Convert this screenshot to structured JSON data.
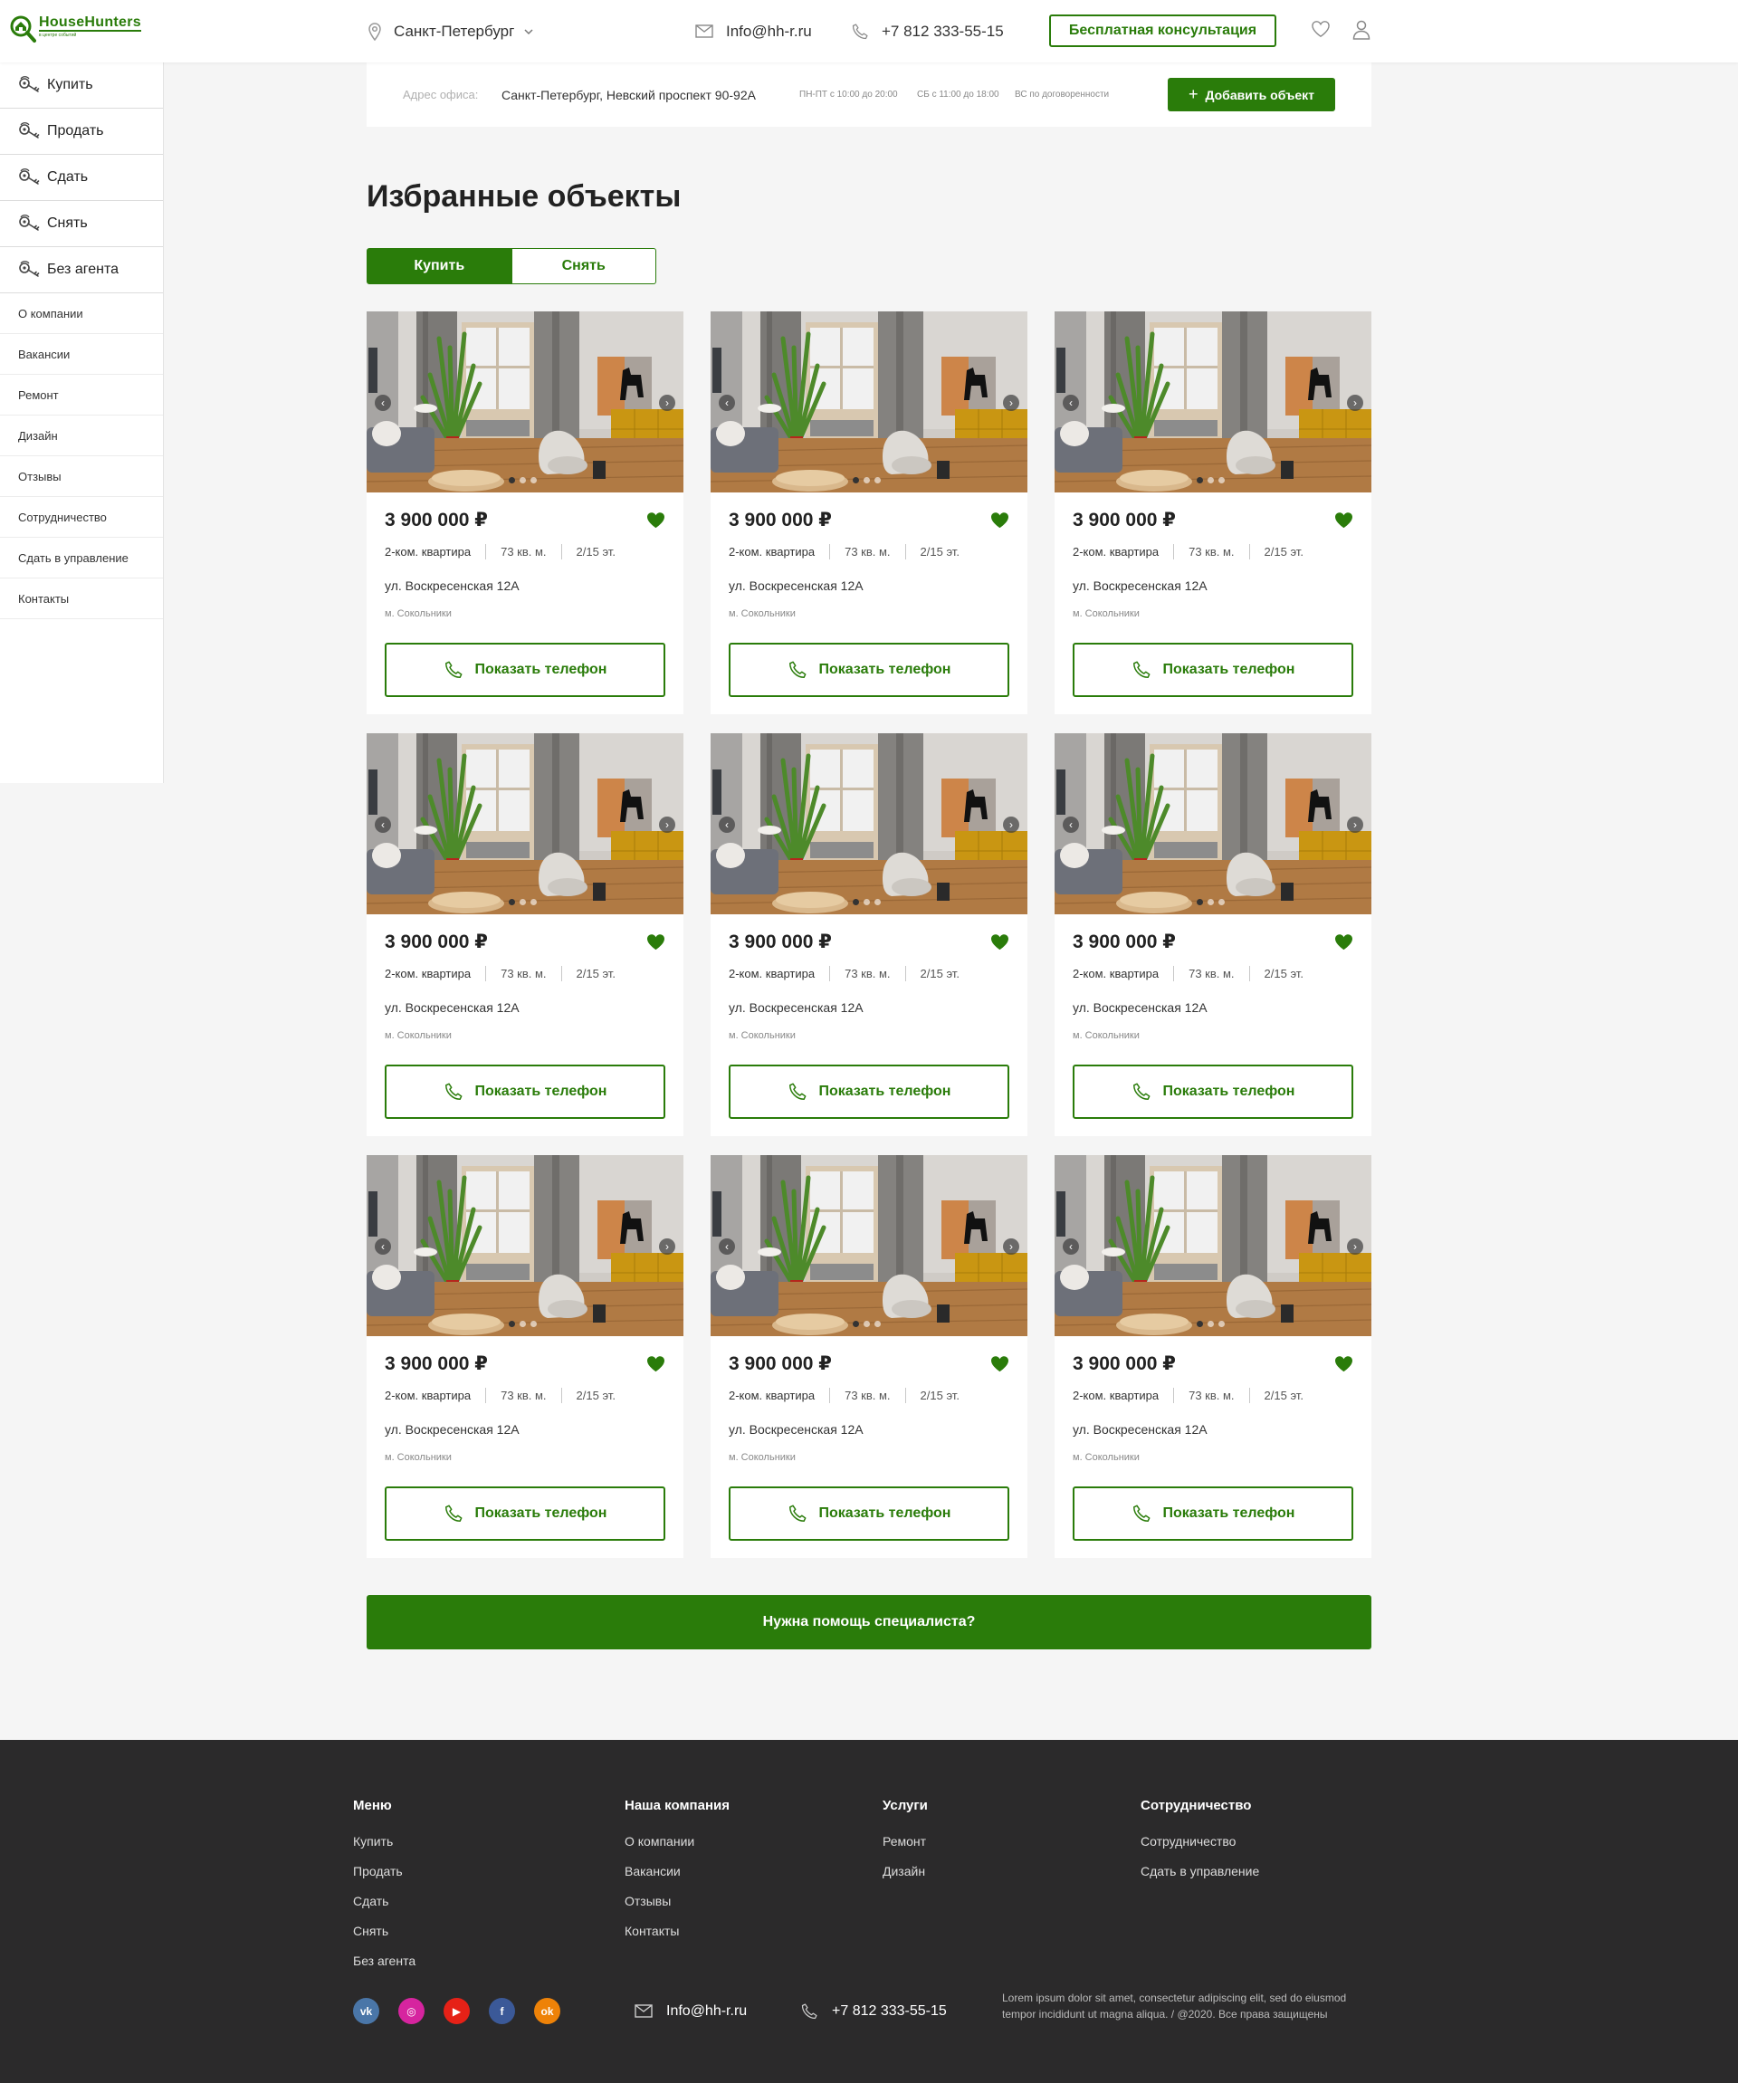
{
  "brand": {
    "name": "HouseHunters",
    "tagline": "в центре событий",
    "color": "#2a7c0a"
  },
  "header": {
    "city": "Санкт-Петербург",
    "email": "Info@hh-r.ru",
    "phone": "+7 812 333-55-15",
    "consult_label": "Бесплатная консультация",
    "icons": [
      "location-pin-icon",
      "chevron-down-icon",
      "mail-icon",
      "phone-icon",
      "heart-icon",
      "user-icon"
    ]
  },
  "sidebar": {
    "main_items": [
      {
        "label": "Купить",
        "icon": "key-icon"
      },
      {
        "label": "Продать",
        "icon": "key-icon"
      },
      {
        "label": "Сдать",
        "icon": "key-icon"
      },
      {
        "label": "Снять",
        "icon": "key-icon"
      },
      {
        "label": "Без агента",
        "icon": "key-icon"
      }
    ],
    "sub_items": [
      "О компании",
      "Вакансии",
      "Ремонт",
      "Дизайн",
      "Отзывы",
      "Сотрудничество",
      "Сдать в управление",
      "Контакты"
    ]
  },
  "office": {
    "label": "Адрес офиса:",
    "address": "Санкт-Петербург, Невский проспект 90-92А",
    "hours_weekdays": "ПН-ПТ с 10:00 до 20:00",
    "hours_saturday": "СБ с 11:00 до 18:00",
    "hours_sunday": "ВС по договоренности",
    "add_label": "Добавить объект"
  },
  "page": {
    "title": "Избранные объекты",
    "tabs": [
      {
        "label": "Купить",
        "active": true
      },
      {
        "label": "Снять",
        "active": false
      }
    ]
  },
  "listings": [
    {
      "price": "3 900 000 ₽",
      "rooms": "2-ком. квартира",
      "area": "73 кв. м.",
      "floor": "2/15 эт.",
      "street": "ул. Воскресенская 12А",
      "metro": "м. Сокольники",
      "button": "Показать телефон",
      "favorite": true,
      "slide": 1
    },
    {
      "price": "3 900 000 ₽",
      "rooms": "2-ком. квартира",
      "area": "73 кв. м.",
      "floor": "2/15 эт.",
      "street": "ул. Воскресенская 12А",
      "metro": "м. Сокольники",
      "button": "Показать телефон",
      "favorite": true,
      "slide": 1
    },
    {
      "price": "3 900 000 ₽",
      "rooms": "2-ком. квартира",
      "area": "73 кв. м.",
      "floor": "2/15 эт.",
      "street": "ул. Воскресенская 12А",
      "metro": "м. Сокольники",
      "button": "Показать телефон",
      "favorite": true,
      "slide": 1
    },
    {
      "price": "3 900 000 ₽",
      "rooms": "2-ком. квартира",
      "area": "73 кв. м.",
      "floor": "2/15 эт.",
      "street": "ул. Воскресенская 12А",
      "metro": "м. Сокольники",
      "button": "Показать телефон",
      "favorite": true,
      "slide": 1
    },
    {
      "price": "3 900 000 ₽",
      "rooms": "2-ком. квартира",
      "area": "73 кв. м.",
      "floor": "2/15 эт.",
      "street": "ул. Воскресенская 12А",
      "metro": "м. Сокольники",
      "button": "Показать телефон",
      "favorite": true,
      "slide": 1
    },
    {
      "price": "3 900 000 ₽",
      "rooms": "2-ком. квартира",
      "area": "73 кв. м.",
      "floor": "2/15 эт.",
      "street": "ул. Воскресенская 12А",
      "metro": "м. Сокольники",
      "button": "Показать телефон",
      "favorite": true,
      "slide": 1
    },
    {
      "price": "3 900 000 ₽",
      "rooms": "2-ком. квартира",
      "area": "73 кв. м.",
      "floor": "2/15 эт.",
      "street": "ул. Воскресенская 12А",
      "metro": "м. Сокольники",
      "button": "Показать телефон",
      "favorite": true,
      "slide": 1
    },
    {
      "price": "3 900 000 ₽",
      "rooms": "2-ком. квартира",
      "area": "73 кв. м.",
      "floor": "2/15 эт.",
      "street": "ул. Воскресенская 12А",
      "metro": "м. Сокольники",
      "button": "Показать телефон",
      "favorite": true,
      "slide": 1
    },
    {
      "price": "3 900 000 ₽",
      "rooms": "2-ком. квартира",
      "area": "73 кв. м.",
      "floor": "2/15 эт.",
      "street": "ул. Воскресенская 12А",
      "metro": "м. Сокольники",
      "button": "Показать телефон",
      "favorite": true,
      "slide": 1
    }
  ],
  "help_label": "Нужна помощь специалиста?",
  "footer": {
    "columns": [
      {
        "title": "Меню",
        "links": [
          "Купить",
          "Продать",
          "Сдать",
          "Снять",
          "Без агента"
        ]
      },
      {
        "title": "Наша компания",
        "links": [
          "О компании",
          "Вакансии",
          "Отзывы",
          "Контакты"
        ]
      },
      {
        "title": "Услуги",
        "links": [
          "Ремонт",
          "Дизайн"
        ]
      },
      {
        "title": "Сотрудничество",
        "links": [
          "Сотрудничество",
          "Сдать в управление"
        ]
      }
    ],
    "social": [
      {
        "name": "vk-icon",
        "glyph": "vk",
        "color": "#4a76a8"
      },
      {
        "name": "instagram-icon",
        "glyph": "◎",
        "color": "#d6249f"
      },
      {
        "name": "youtube-icon",
        "glyph": "▶",
        "color": "#e62117"
      },
      {
        "name": "facebook-icon",
        "glyph": "f",
        "color": "#3b5998"
      },
      {
        "name": "odnoklassniki-icon",
        "glyph": "ok",
        "color": "#ee8208"
      }
    ],
    "email": "Info@hh-r.ru",
    "phone": "+7 812 333-55-15",
    "legal_line1": "Lorem ipsum dolor sit amet, consectetur adipiscing elit, sed do eiusmod",
    "legal_line2": "tempor incididunt ut  magna aliqua.  / @2020. Все права защищены"
  }
}
